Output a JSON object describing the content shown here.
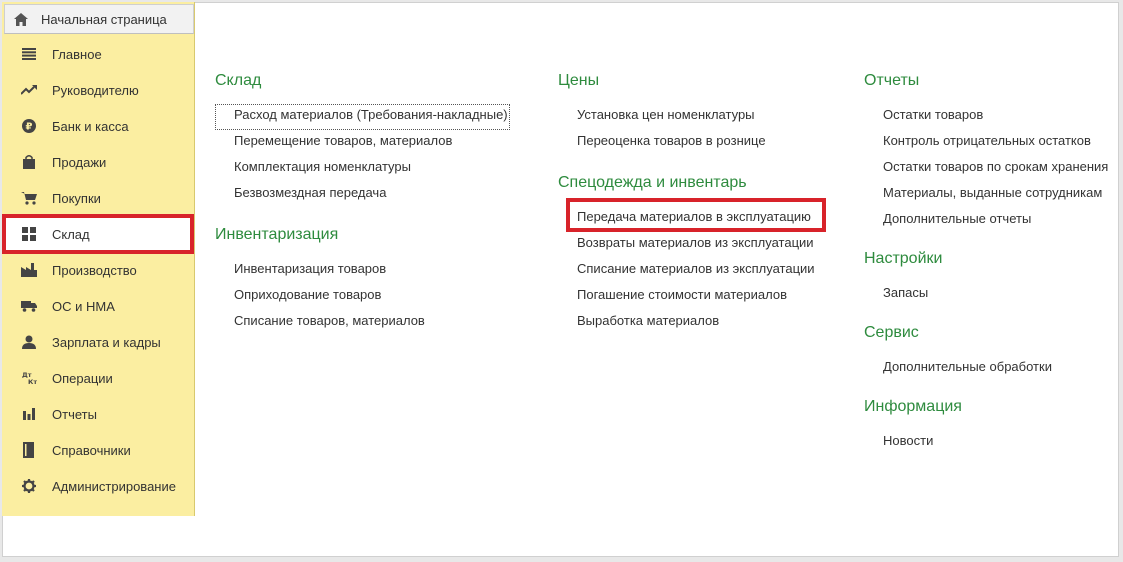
{
  "home_tab": {
    "label": "Начальная страница"
  },
  "sidebar": {
    "items": [
      {
        "label": "Главное",
        "icon": "menu-lines-icon"
      },
      {
        "label": "Руководителю",
        "icon": "trend-arrow-icon"
      },
      {
        "label": "Банк и касса",
        "icon": "ruble-coin-icon"
      },
      {
        "label": "Продажи",
        "icon": "shopping-bag-icon"
      },
      {
        "label": "Покупки",
        "icon": "cart-icon"
      },
      {
        "label": "Склад",
        "icon": "warehouse-grid-icon",
        "active": true
      },
      {
        "label": "Производство",
        "icon": "factory-icon"
      },
      {
        "label": "ОС и НМА",
        "icon": "truck-icon"
      },
      {
        "label": "Зарплата и кадры",
        "icon": "person-icon"
      },
      {
        "label": "Операции",
        "icon": "dt-kt-icon"
      },
      {
        "label": "Отчеты",
        "icon": "bar-chart-icon"
      },
      {
        "label": "Справочники",
        "icon": "book-icon"
      },
      {
        "label": "Администрирование",
        "icon": "gear-icon"
      }
    ]
  },
  "icon_text": {
    "dt": "Дт",
    "kt": "Кт"
  },
  "columns": [
    {
      "groups": [
        {
          "title": "Склад",
          "links": [
            "Расход материалов (Требования-накладные)",
            "Перемещение товаров, материалов",
            "Комплектация номенклатуры",
            "Безвозмездная передача"
          ]
        },
        {
          "title": "Инвентаризация",
          "links": [
            "Инвентаризация товаров",
            "Оприходование товаров",
            "Списание товаров, материалов"
          ]
        }
      ]
    },
    {
      "groups": [
        {
          "title": "Цены",
          "links": [
            "Установка цен номенклатуры",
            "Переоценка товаров в рознице"
          ]
        },
        {
          "title": "Спецодежда и инвентарь",
          "links": [
            "Передача материалов в эксплуатацию",
            "Возвраты материалов из эксплуатации",
            "Списание материалов из эксплуатации",
            "Погашение стоимости материалов",
            "Выработка материалов"
          ]
        }
      ]
    },
    {
      "groups": [
        {
          "title": "Отчеты",
          "links": [
            "Остатки товаров",
            "Контроль отрицательных остатков",
            "Остатки товаров по срокам хранения",
            "Материалы, выданные сотрудникам",
            "Дополнительные отчеты"
          ]
        },
        {
          "title": "Настройки",
          "links": [
            "Запасы"
          ]
        },
        {
          "title": "Сервис",
          "links": [
            "Дополнительные обработки"
          ]
        },
        {
          "title": "Информация",
          "links": [
            "Новости"
          ]
        }
      ]
    }
  ],
  "colors": {
    "accent_green": "#2e8b3e",
    "sidebar_bg": "#fbeea1",
    "highlight_red": "#d8232a"
  }
}
